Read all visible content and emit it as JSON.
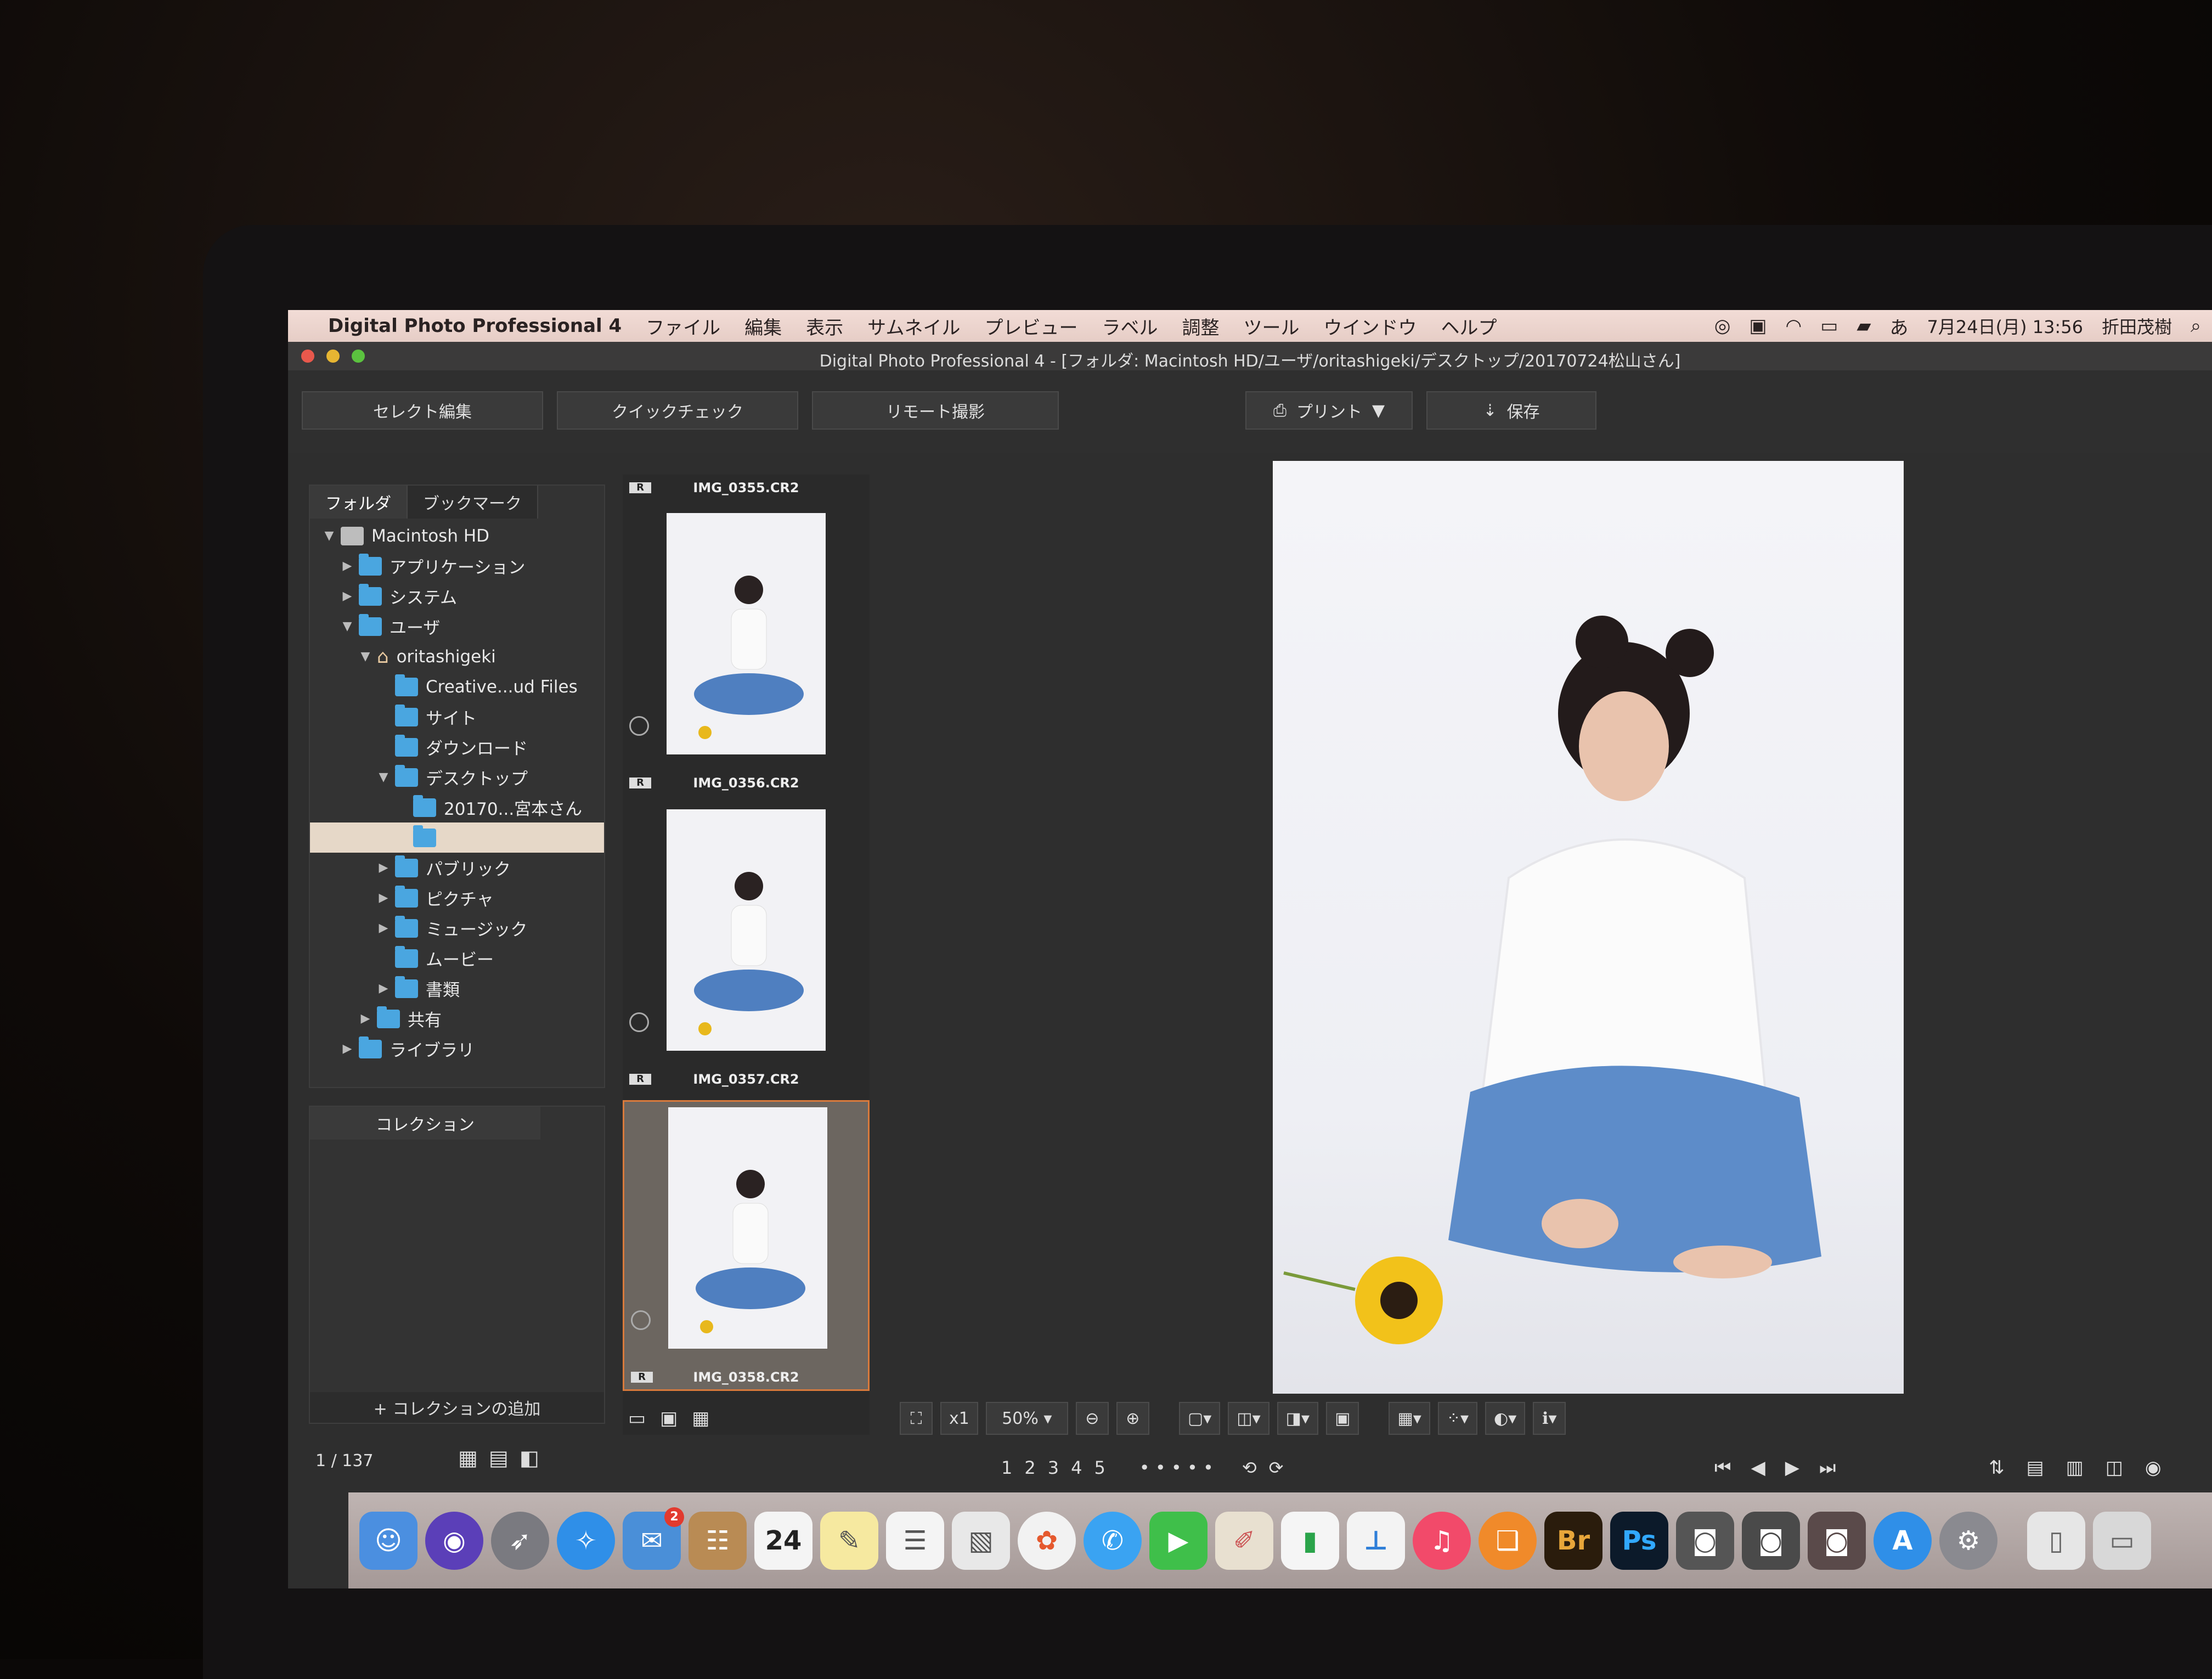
{
  "menubar": {
    "apple_glyph": "",
    "app_name": "Digital Photo Professional 4",
    "items": [
      "ファイル",
      "編集",
      "表示",
      "サムネイル",
      "プレビュー",
      "ラベル",
      "調整",
      "ツール",
      "ウインドウ",
      "ヘルプ"
    ],
    "date_time": "7月24日(月) 13:56",
    "user": "折田茂樹",
    "input_mode": "あ"
  },
  "window": {
    "title": "Digital Photo Professional 4 - [フォルダ: Macintosh HD/ユーザ/oritashigeki/デスクトップ/20170724松山さん]"
  },
  "toolbar": {
    "select_edit": "セレクト編集",
    "quick_check": "クイックチェック",
    "remote_shoot": "リモート撮影",
    "print": "プリント",
    "save": "保存"
  },
  "folder_panel": {
    "tab_folder": "フォルダ",
    "tab_bookmark": "ブックマーク",
    "tree": [
      {
        "label": "Macintosh HD",
        "depth": 0,
        "arrow": "▼",
        "icon": "disk"
      },
      {
        "label": "アプリケーション",
        "depth": 1,
        "arrow": "▶",
        "icon": "folder"
      },
      {
        "label": "システム",
        "depth": 1,
        "arrow": "▶",
        "icon": "folder"
      },
      {
        "label": "ユーザ",
        "depth": 1,
        "arrow": "▼",
        "icon": "folder"
      },
      {
        "label": "oritashigeki",
        "depth": 2,
        "arrow": "▼",
        "icon": "home"
      },
      {
        "label": "Creative...ud Files",
        "depth": 3,
        "arrow": "",
        "icon": "folder"
      },
      {
        "label": "サイト",
        "depth": 3,
        "arrow": "",
        "icon": "folder"
      },
      {
        "label": "ダウンロード",
        "depth": 3,
        "arrow": "",
        "icon": "folder"
      },
      {
        "label": "デスクトップ",
        "depth": 3,
        "arrow": "▼",
        "icon": "folder"
      },
      {
        "label": "20170...宮本さん",
        "depth": 4,
        "arrow": "",
        "icon": "folder"
      },
      {
        "label": "",
        "depth": 4,
        "arrow": "",
        "icon": "folder",
        "selected": true
      },
      {
        "label": "パブリック",
        "depth": 3,
        "arrow": "▶",
        "icon": "folder"
      },
      {
        "label": "ピクチャ",
        "depth": 3,
        "arrow": "▶",
        "icon": "folder"
      },
      {
        "label": "ミュージック",
        "depth": 3,
        "arrow": "▶",
        "icon": "folder"
      },
      {
        "label": "ムービー",
        "depth": 3,
        "arrow": "",
        "icon": "folder"
      },
      {
        "label": "書類",
        "depth": 3,
        "arrow": "▶",
        "icon": "folder"
      },
      {
        "label": "共有",
        "depth": 2,
        "arrow": "▶",
        "icon": "folder"
      },
      {
        "label": "ライブラリ",
        "depth": 1,
        "arrow": "▶",
        "icon": "folder"
      }
    ]
  },
  "collection_panel": {
    "tab": "コレクション",
    "add_button": "+ コレクションの追加"
  },
  "status": {
    "counter": "1 / 137"
  },
  "thumbnails": {
    "badge": "R",
    "items": [
      {
        "name": "IMG_0355.CR2"
      },
      {
        "name": "IMG_0356.CR2"
      },
      {
        "name": "IMG_0357.CR2"
      },
      {
        "name": "IMG_0358.CR2",
        "selected": true
      }
    ]
  },
  "preview": {
    "zoom_multiplier": "x1",
    "zoom_level": "50%"
  },
  "bottom": {
    "labels": [
      "1",
      "2",
      "3",
      "4",
      "5"
    ]
  },
  "dock": {
    "calendar_day": "24",
    "mail_badge": "2",
    "bridge_label": "Br",
    "photoshop_label": "Ps"
  },
  "colors": {
    "accent_selected": "#d87a3c",
    "folder_blue": "#4aa6e0"
  }
}
